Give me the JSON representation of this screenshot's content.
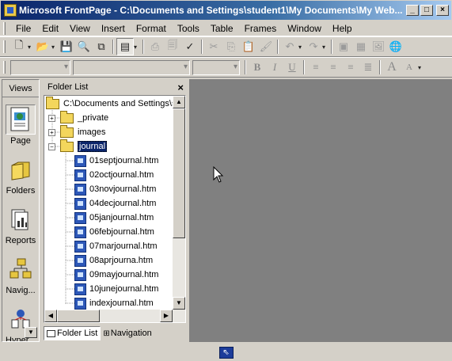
{
  "window": {
    "title": "Microsoft FrontPage - C:\\Documents and Settings\\student1\\My Documents\\My Web...",
    "controls": [
      "minimize",
      "maximize",
      "close"
    ]
  },
  "menu": [
    {
      "label": "File"
    },
    {
      "label": "Edit"
    },
    {
      "label": "View"
    },
    {
      "label": "Insert"
    },
    {
      "label": "Format"
    },
    {
      "label": "Tools"
    },
    {
      "label": "Table"
    },
    {
      "label": "Frames"
    },
    {
      "label": "Window"
    },
    {
      "label": "Help"
    }
  ],
  "format_toolbar": {
    "bold": "B",
    "italic": "I",
    "underline": "U",
    "grow": "A",
    "shrink": "A"
  },
  "views": {
    "header": "Views",
    "items": [
      {
        "label": "Page",
        "icon": "page-view-icon",
        "active": true
      },
      {
        "label": "Folders",
        "icon": "folders-view-icon"
      },
      {
        "label": "Reports",
        "icon": "reports-view-icon"
      },
      {
        "label": "Navig...",
        "icon": "navigation-view-icon"
      },
      {
        "label": "Hyper...",
        "icon": "hyperlinks-view-icon"
      }
    ]
  },
  "folder_list": {
    "title": "Folder List",
    "root": "C:\\Documents and Settings\\st",
    "folders": [
      {
        "name": "_private",
        "expanded": false
      },
      {
        "name": "images",
        "expanded": false
      },
      {
        "name": "journal",
        "expanded": true,
        "selected": true
      }
    ],
    "files": [
      "01septjournal.htm",
      "02octjournal.htm",
      "03novjournal.htm",
      "04decjournal.htm",
      "05janjournal.htm",
      "06febjournal.htm",
      "07marjournal.htm",
      "08aprjourna.htm",
      "09mayjournal.htm",
      "10junejournal.htm",
      "indexjournal.htm"
    ],
    "tabs": [
      {
        "label": "Folder List",
        "active": true
      },
      {
        "label": "Navigation",
        "active": false
      }
    ]
  },
  "colors": {
    "titlebar": "#0a246a",
    "workspace": "#808080",
    "selection": "#0a246a"
  }
}
